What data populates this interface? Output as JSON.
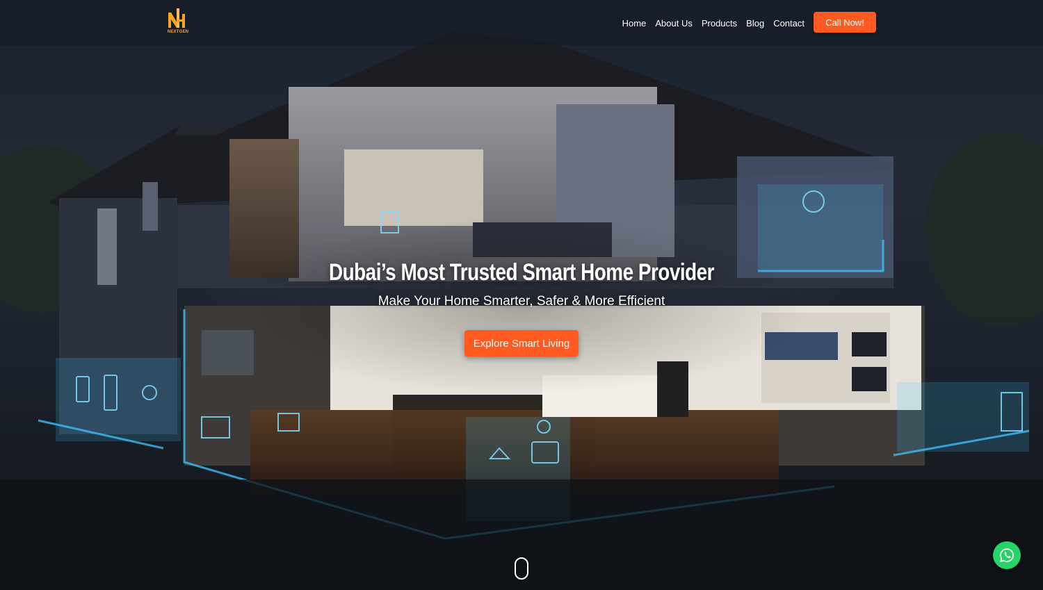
{
  "logo": {
    "letters": "NH",
    "sub_text": "NEXTGEN",
    "brand_color": "#f5a623"
  },
  "nav": {
    "items": [
      "Home",
      "About Us",
      "Products",
      "Blog",
      "Contact"
    ],
    "cta_label": "Call Now!"
  },
  "hero": {
    "title": "Dubai’s Most Trusted Smart Home Provider",
    "subtitle": "Make Your Home Smarter, Safer & More Efficient",
    "cta_label": "Explore Smart Living"
  },
  "colors": {
    "accent": "#ff5a1f",
    "whatsapp": "#25d366",
    "glow": "#3fc6ff"
  },
  "icons": {
    "scroll": "mouse-scroll-icon",
    "whatsapp": "whatsapp-icon"
  }
}
